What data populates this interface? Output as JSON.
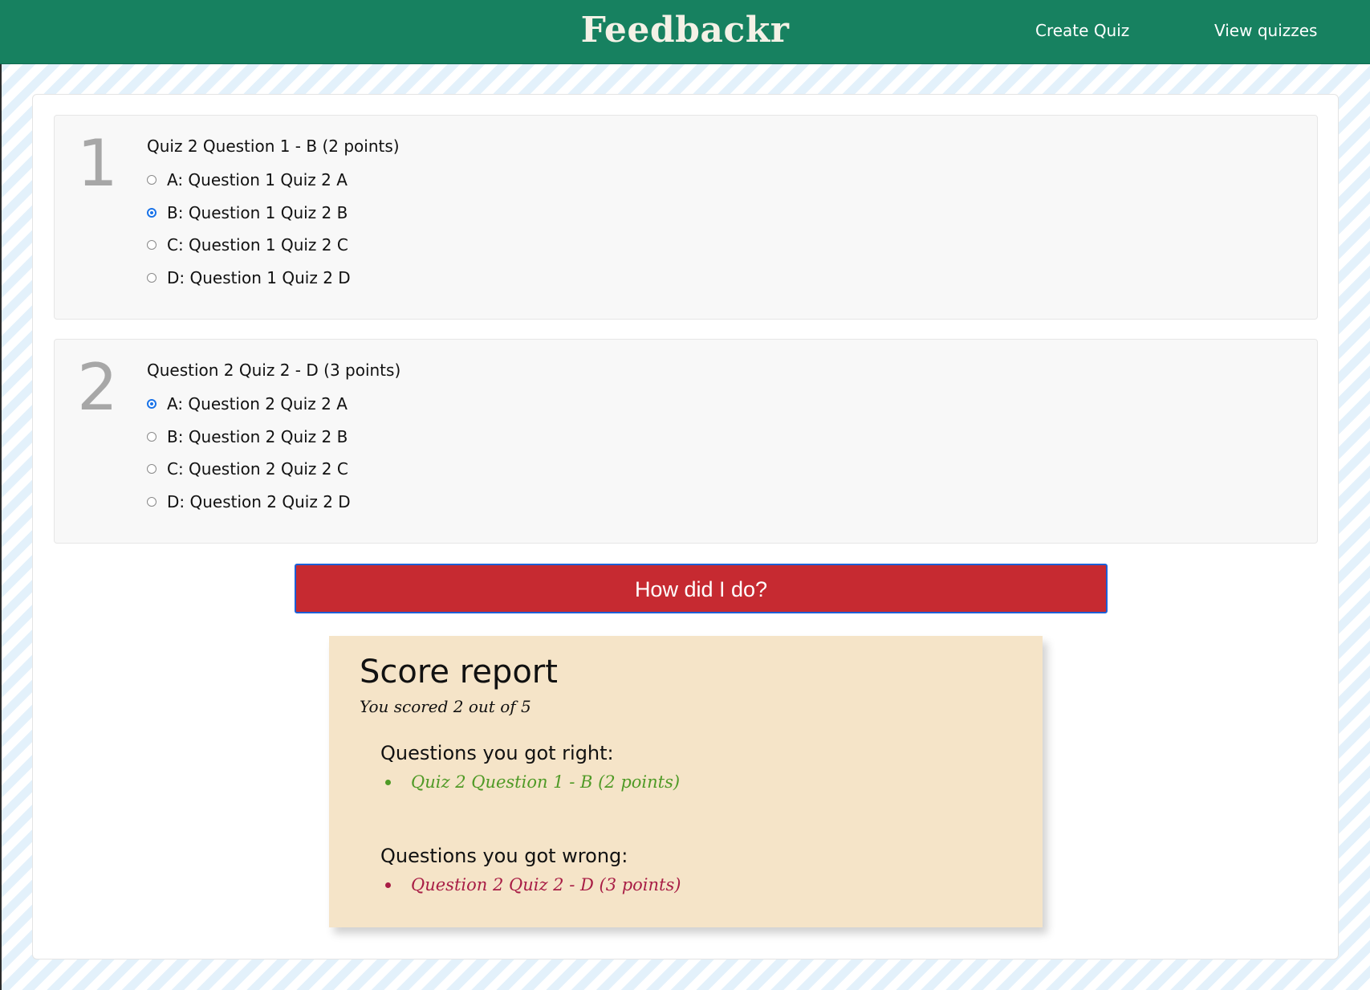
{
  "header": {
    "brand": "Feedbackr",
    "nav": {
      "create_quiz": "Create Quiz",
      "view_quizzes": "View quizzes"
    },
    "color": "#178160"
  },
  "questions": [
    {
      "number": "1",
      "text": "Quiz 2 Question 1 - B (2 points)",
      "options": [
        {
          "label": "A: Question 1 Quiz 2 A",
          "selected": false
        },
        {
          "label": "B: Question 1 Quiz 2 B",
          "selected": true
        },
        {
          "label": "C: Question 1 Quiz 2 C",
          "selected": false
        },
        {
          "label": "D: Question 1 Quiz 2 D",
          "selected": false
        }
      ]
    },
    {
      "number": "2",
      "text": "Question 2 Quiz 2 - D (3 points)",
      "options": [
        {
          "label": "A: Question 2 Quiz 2 A",
          "selected": true
        },
        {
          "label": "B: Question 2 Quiz 2 B",
          "selected": false
        },
        {
          "label": "C: Question 2 Quiz 2 C",
          "selected": false
        },
        {
          "label": "D: Question 2 Quiz 2 D",
          "selected": false
        }
      ]
    }
  ],
  "submit_button": {
    "label": "How did I do?",
    "color": "#c62a31"
  },
  "score_report": {
    "title": "Score report",
    "score_text": "You scored 2 out of 5",
    "right_heading": "Questions you got right:",
    "right_items": [
      "Quiz 2 Question 1 - B (2 points)"
    ],
    "wrong_heading": "Questions you got wrong:",
    "wrong_items": [
      "Question 2 Quiz 2 - D (3 points)"
    ],
    "right_color": "#4f9a26",
    "wrong_color": "#a81d45",
    "background": "#f5e4c8"
  }
}
